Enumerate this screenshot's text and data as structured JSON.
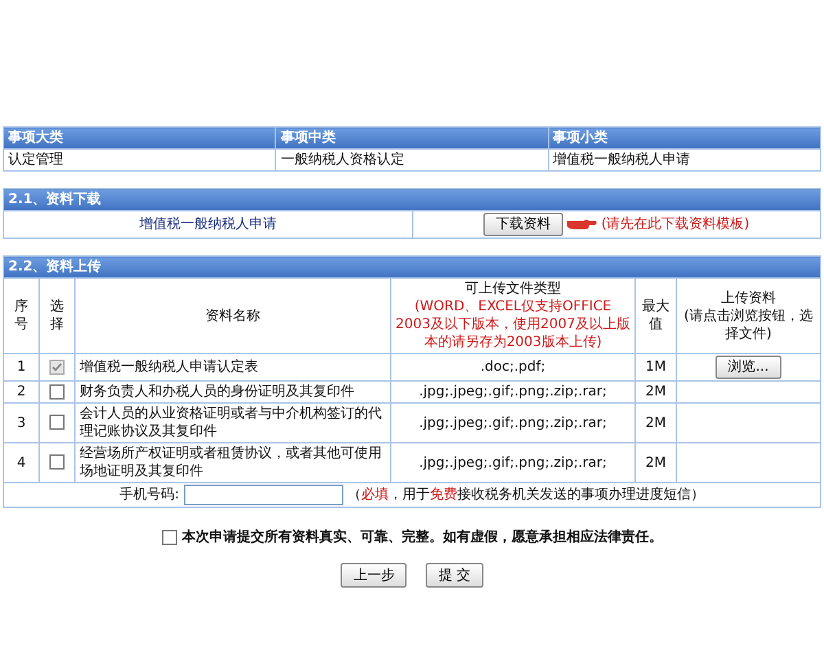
{
  "category": {
    "columns": [
      "事项大类",
      "事项中类",
      "事项小类"
    ],
    "row": [
      "认定管理",
      "一般纳税人资格认定",
      "增值税一般纳税人申请"
    ]
  },
  "download": {
    "title": "2.1、资料下载",
    "item": "增值税一般纳税人申请",
    "button": "下载资料",
    "hint": "(请先在此下载资料模板)"
  },
  "upload": {
    "title": "2.2、资料上传",
    "columns": {
      "index": "序号",
      "select": "选择",
      "name": "资料名称",
      "types": "可上传文件类型",
      "types_note": "(WORD、EXCEL仅支持OFFICE 2003及以下版本，使用2007及以上版本的请另存为2003版本上传)",
      "max": "最大值",
      "upload": "上传资料",
      "upload_note": "(请点击浏览按钮，选择文件)"
    },
    "rows": [
      {
        "index": "1",
        "checked": true,
        "disabled": true,
        "name": "增值税一般纳税人申请认定表",
        "types": ".doc;.pdf;",
        "max": "1M",
        "browse": "浏览..."
      },
      {
        "index": "2",
        "checked": false,
        "disabled": false,
        "name": "财务负责人和办税人员的身份证明及其复印件",
        "types": ".jpg;.jpeg;.gif;.png;.zip;.rar;",
        "max": "2M"
      },
      {
        "index": "3",
        "checked": false,
        "disabled": false,
        "name": "会计人员的从业资格证明或者与中介机构签订的代理记账协议及其复印件",
        "types": ".jpg;.jpeg;.gif;.png;.zip;.rar;",
        "max": "2M"
      },
      {
        "index": "4",
        "checked": false,
        "disabled": false,
        "name": "经营场所产权证明或者租赁协议，或者其他可使用场地证明及其复印件",
        "types": ".jpg;.jpeg;.gif;.png;.zip;.rar;",
        "max": "2M"
      }
    ],
    "phone": {
      "label": "手机号码:",
      "note": [
        {
          "text": "（",
          "highlight": false
        },
        {
          "text": "必填",
          "highlight": true
        },
        {
          "text": "，用于",
          "highlight": false
        },
        {
          "text": "免费",
          "highlight": true
        },
        {
          "text": "接收税务机关发送的事项办理进度短信）",
          "highlight": false
        }
      ]
    }
  },
  "declaration": {
    "checked": false,
    "text": "本次申请提交所有资料真实、可靠、完整。如有虚假，愿意承担相应法律责任。"
  },
  "buttons": [
    "上一步",
    "提 交"
  ]
}
